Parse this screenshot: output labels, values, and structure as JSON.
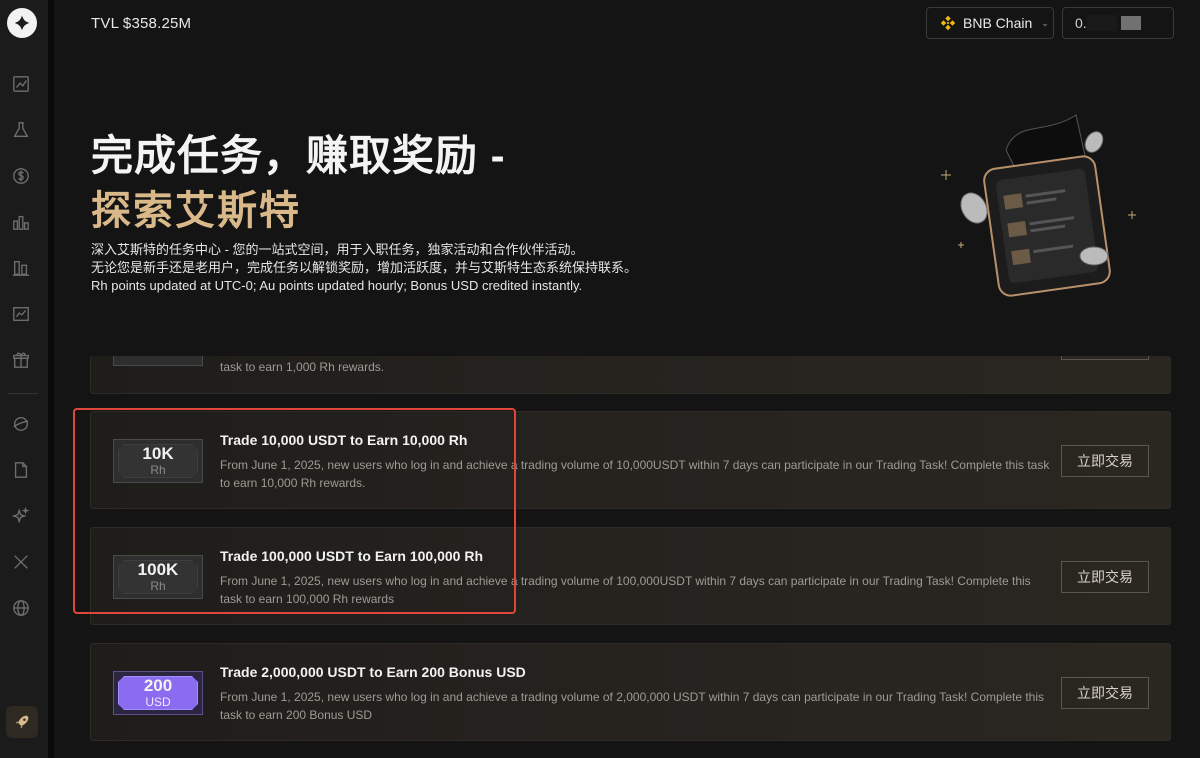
{
  "header": {
    "tvl": "TVL $358.25M",
    "chain_label": "BNB Chain",
    "wallet_label": "0."
  },
  "sidebar": {
    "items": [
      {
        "name": "chart-icon"
      },
      {
        "name": "flask-icon"
      },
      {
        "name": "dollar-icon"
      },
      {
        "name": "bar-chart-icon"
      },
      {
        "name": "stats-icon"
      },
      {
        "name": "line-chart-icon"
      },
      {
        "name": "gift-icon"
      },
      {
        "name": "planet-icon"
      },
      {
        "name": "document-icon"
      },
      {
        "name": "sparkle-icon"
      },
      {
        "name": "x-icon"
      },
      {
        "name": "globe-icon"
      }
    ]
  },
  "hero": {
    "title_line1": "完成任务，赚取奖励 -",
    "title_line2": "探索艾斯特",
    "desc_line1": "深入艾斯特的任务中心 - 您的一站式空间，用于入职任务，独家活动和合作伙伴活动。",
    "desc_line2": "无论您是新手还是老用户，完成任务以解锁奖励，增加活跃度，并与艾斯特生态系统保持联系。",
    "desc_line3": "Rh points updated at UTC-0; Au points updated hourly; Bonus USD credited instantly."
  },
  "partial_task": {
    "desc": "task to earn 1,000 Rh rewards."
  },
  "tasks": [
    {
      "badge_value": "10K",
      "badge_unit": "Rh",
      "title": "Trade 10,000 USDT to Earn 10,000 Rh",
      "desc": "From June 1, 2025, new users who log in and achieve a trading volume of 10,000USDT within 7 days can participate in our Trading Task! Complete this task to earn 10,000 Rh rewards.",
      "button": "立即交易"
    },
    {
      "badge_value": "100K",
      "badge_unit": "Rh",
      "title": "Trade 100,000 USDT to Earn 100,000 Rh",
      "desc": "From June 1, 2025, new users who log in and achieve a trading volume of 100,000USDT within 7 days can participate in our Trading Task! Complete this task to earn 100,000 Rh rewards",
      "button": "立即交易"
    },
    {
      "badge_value": "200",
      "badge_unit": "USD",
      "title": "Trade 2,000,000 USDT to Earn 200 Bonus USD",
      "desc": "From June 1, 2025, new users who log in and achieve a trading volume of 2,000,000 USDT within 7 days can participate in our Trading Task! Complete this task to earn 200 Bonus USD",
      "button": "立即交易"
    }
  ],
  "colors": {
    "accent_gold": "#d9b98a",
    "highlight_red": "#e0473a",
    "usd_badge_purple": "#8b6cf0"
  }
}
